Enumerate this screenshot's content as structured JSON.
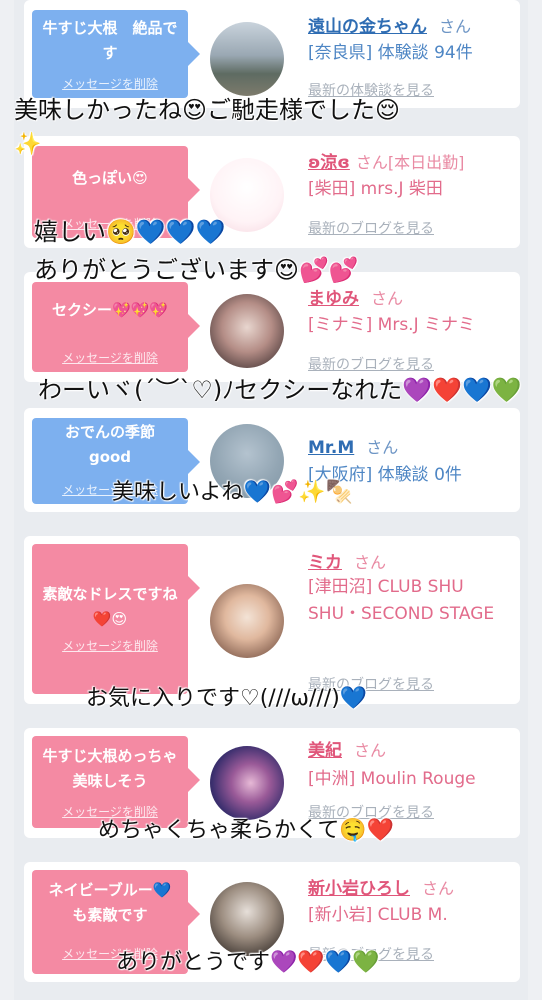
{
  "cards": [
    {
      "bubble_color": "#7db0ef",
      "message": "牛すじ大根　絶品です",
      "delete_label": "メッセージを削除",
      "name": "遠山の金ちゃん",
      "honorific": "さん",
      "info": "[奈良県] 体験談 94件",
      "latest_label": "最新の体験談を見る"
    },
    {
      "bubble_color": "#f48aa3",
      "message": "色っぽい😍",
      "delete_label": "メッセージを削除",
      "name": "ʚ涼ɞ",
      "honorific": "さん[本日出勤]",
      "info": "[柴田] mrs.J 柴田",
      "latest_label": "最新のブログを見る"
    },
    {
      "bubble_color": "#f48aa3",
      "message": "セクシー💖💖💖",
      "delete_label": "メッセージを削除",
      "name": "まゆみ",
      "honorific": "さん",
      "info": "[ミナミ] Mrs.J ミナミ",
      "latest_label": "最新のブログを見る"
    },
    {
      "bubble_color": "#7db0ef",
      "message": "おでんの季節 good",
      "delete_label": "メッセージを削除",
      "name": "Mr.M",
      "honorific": "さん",
      "info": "[大阪府] 体験談 0件",
      "latest_label": ""
    },
    {
      "bubble_color": "#f48aa3",
      "message": "素敵なドレスですね❤️😍",
      "delete_label": "メッセージを削除",
      "name": "ミカ",
      "honorific": "さん",
      "info": "[津田沼] CLUB SHU SHU・SECOND STAGE",
      "latest_label": "最新のブログを見る"
    },
    {
      "bubble_color": "#f48aa3",
      "message": "牛すじ大根めっちゃ美味しそう",
      "delete_label": "メッセージを削除",
      "name": "美紀",
      "honorific": "さん",
      "info": "[中洲] Moulin Rouge",
      "latest_label": "最新のブログを見る"
    },
    {
      "bubble_color": "#f48aa3",
      "message": "ネイビーブルー💙も素敵です",
      "delete_label": "メッセージを削除",
      "name": "新小岩ひろし",
      "honorific": "さん",
      "info": "[新小岩] CLUB M.",
      "latest_label": "最新のブログを見る"
    }
  ],
  "overlays": [
    "美味しかったね😍ご馳走様でした😌",
    "✨",
    "嬉しい🥺💙💙💙",
    "ありがとうございます😍💕💕",
    "わーいヾ(´︶`♡)ﾉセクシーなれた💜❤️💙💚",
    "美味しいよね💙💕✨🍢",
    "お気に入りです♡(///ω///)💙",
    "めちゃくちゃ柔らかくて🤤❤️",
    "ありがとうです💜❤️💙💚"
  ]
}
